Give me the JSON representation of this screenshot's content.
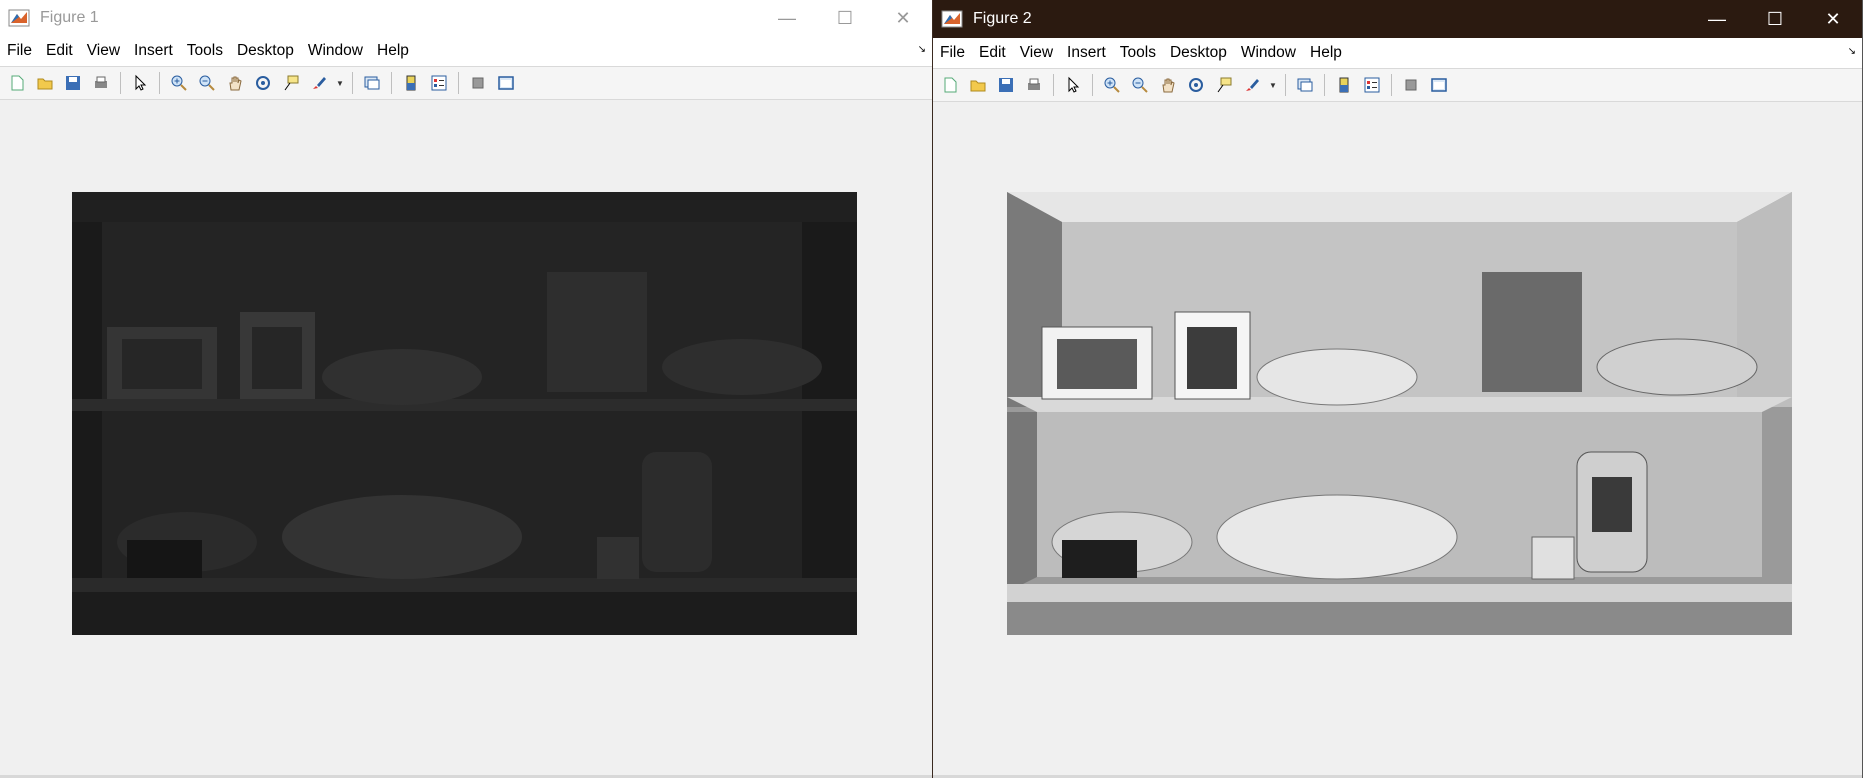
{
  "figure1": {
    "title": "Figure 1",
    "menu": [
      "File",
      "Edit",
      "View",
      "Insert",
      "Tools",
      "Desktop",
      "Window",
      "Help"
    ],
    "image_brightness": "dark"
  },
  "figure2": {
    "title": "Figure 2",
    "menu": [
      "File",
      "Edit",
      "View",
      "Insert",
      "Tools",
      "Desktop",
      "Window",
      "Help"
    ],
    "image_brightness": "enhanced"
  },
  "icons": {
    "toolbar": [
      "new-figure-icon",
      "open-icon",
      "save-icon",
      "print-icon",
      "pointer-icon",
      "zoom-in-icon",
      "zoom-out-icon",
      "pan-icon",
      "rotate-3d-icon",
      "data-cursor-icon",
      "brush-icon",
      "link-plot-icon",
      "colorbar-icon",
      "legend-icon",
      "hide-plot-tools-icon",
      "show-plot-tools-icon"
    ]
  },
  "colors": {
    "figure2_titlebar": "#2b1a10",
    "window_bg": "#f0f0f0"
  }
}
